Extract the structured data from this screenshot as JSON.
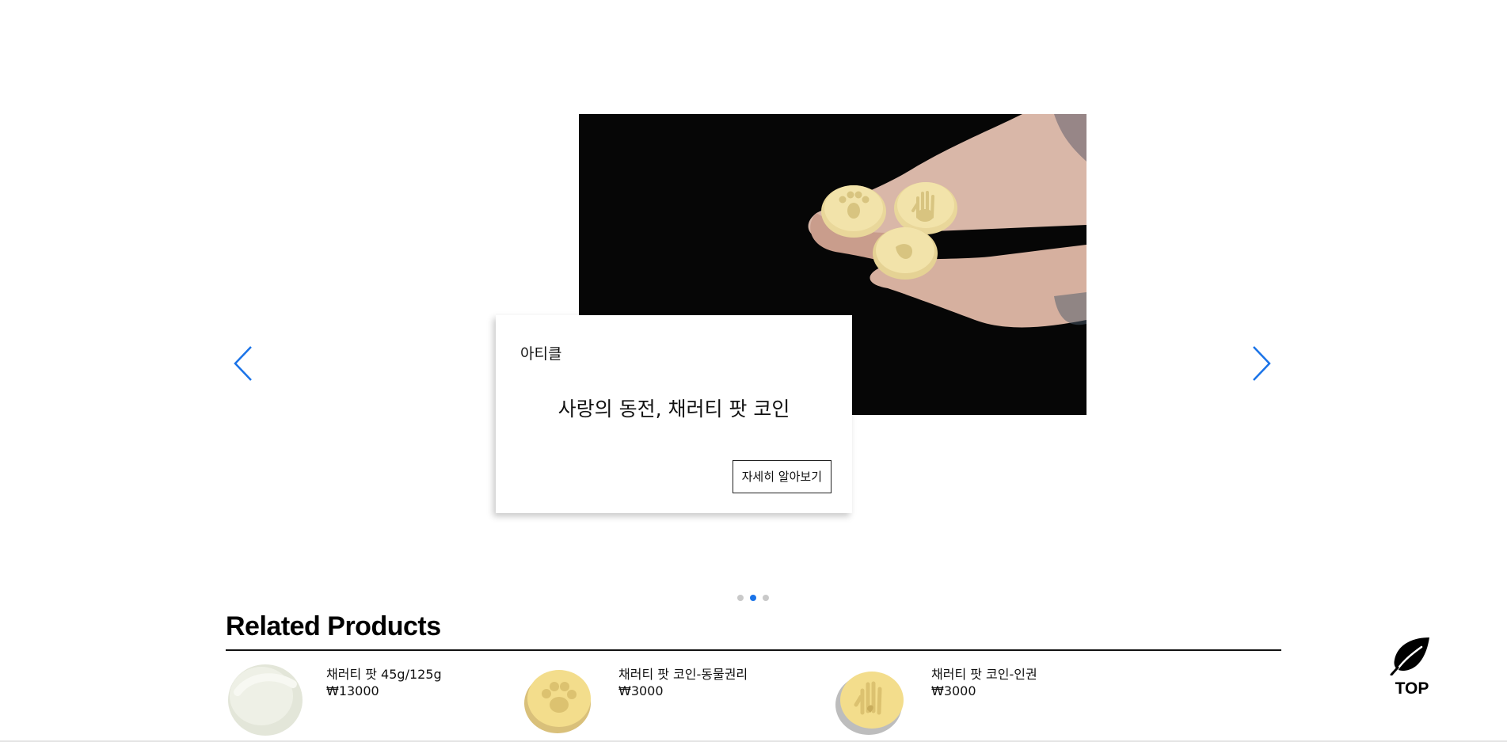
{
  "carousel": {
    "slide": {
      "category": "아티클",
      "title": "사랑의 동전, 채러티 팟 코인",
      "cta_label": "자세히 알아보기"
    },
    "dots_count": 3,
    "active_dot": 1,
    "arrow_color": "#1a73e8"
  },
  "related": {
    "title": "Related Products",
    "products": [
      {
        "name": "채러티 팟 45g/125g",
        "price": "₩13000",
        "thumb": "cream-swatch"
      },
      {
        "name": "채러티 팟 코인-동물권리",
        "price": "₩3000",
        "thumb": "paw-coin"
      },
      {
        "name": "채러티 팟 코인-인권",
        "price": "₩3000",
        "thumb": "hand-coin"
      }
    ]
  },
  "top_button": {
    "label": "TOP",
    "icon": "leaf-icon"
  }
}
